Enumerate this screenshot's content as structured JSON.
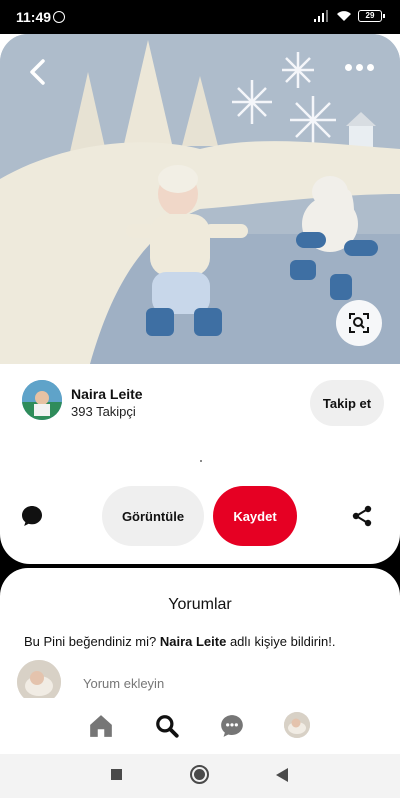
{
  "status_bar": {
    "time": "11:49",
    "battery": "29"
  },
  "pin": {
    "creator_name": "Naira Leite",
    "followers": "393 Takipçi",
    "follow_label": "Takip et",
    "view_label": "Görüntüle",
    "save_label": "Kaydet"
  },
  "comments": {
    "title": "Yorumlar",
    "prompt_prefix": "Bu Pini beğendiniz mi? ",
    "prompt_name": "Naira Leite",
    "prompt_suffix": " adlı kişiye bildirin!.",
    "input_placeholder": "Yorum ekleyin"
  },
  "colors": {
    "accent": "#e60023",
    "secondary_button": "#efefef"
  },
  "icons": {
    "back": "chevron-left-icon",
    "more": "more-horizontal-icon",
    "visual_search": "visual-search-icon",
    "comment": "comment-bubble-icon",
    "share": "share-icon",
    "home": "home-icon",
    "search": "search-icon",
    "messages": "chat-icon"
  }
}
